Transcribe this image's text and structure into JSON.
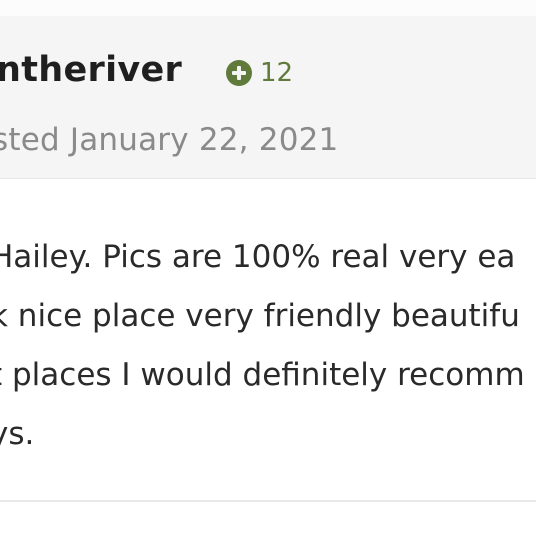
{
  "post": {
    "author": "ntheriver",
    "reputation": "12",
    "posted_label": "sted",
    "posted_date": "January 22, 2021",
    "body_lines": [
      "Hailey. Pics are 100% real very ea",
      "k nice place very friendly beautifu",
      "t places I would definitely recomm",
      "ys."
    ]
  },
  "colors": {
    "header_bg": "#f5f5f5",
    "reputation_green": "#5f7a3b",
    "muted_text": "#8a8a8a"
  },
  "icons": {
    "reputation": "plus-circle-icon"
  }
}
